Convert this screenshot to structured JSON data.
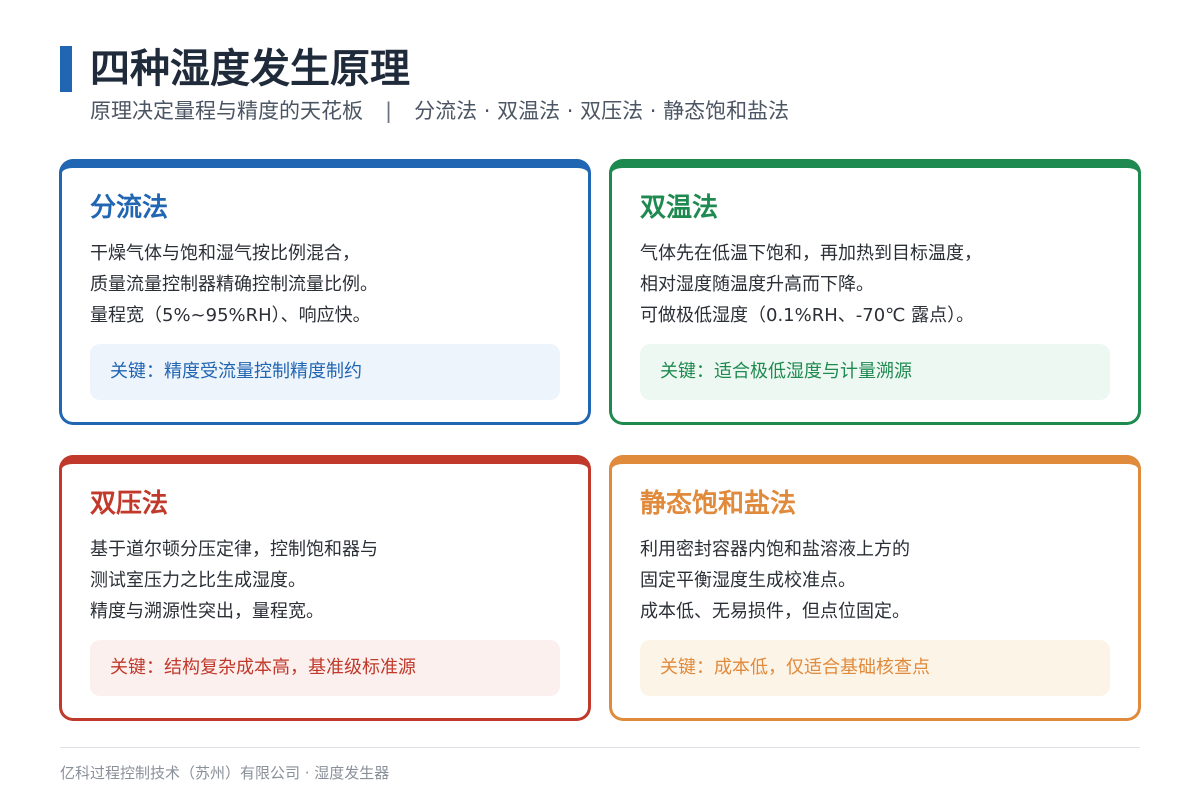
{
  "header": {
    "title": "四种湿度发生原理",
    "subtitle_left": "原理决定量程与精度的天花板",
    "subtitle_sep": "|",
    "subtitle_right": "分流法 · 双温法 · 双压法 · 静态饱和盐法"
  },
  "cards": [
    {
      "title": "分流法",
      "color": "#2166b2",
      "bg": "#eef4fc",
      "lines": [
        "干燥气体与饱和湿气按比例混合，",
        "质量流量控制器精确控制流量比例。",
        "量程宽（5%~95%RH）、响应快。"
      ],
      "key": "关键：精度受流量控制精度制约"
    },
    {
      "title": "双温法",
      "color": "#1e8a50",
      "bg": "#eef8f2",
      "lines": [
        "气体先在低温下饱和，再加热到目标温度，",
        "相对湿度随温度升高而下降。",
        "可做极低湿度（0.1%RH、-70℃ 露点）。"
      ],
      "key": "关键：适合极低湿度与计量溯源"
    },
    {
      "title": "双压法",
      "color": "#c0392b",
      "bg": "#fcf0ef",
      "lines": [
        "基于道尔顿分压定律，控制饱和器与",
        "测试室压力之比生成湿度。",
        "精度与溯源性突出，量程宽。"
      ],
      "key": "关键：结构复杂成本高，基准级标准源"
    },
    {
      "title": "静态饱和盐法",
      "color": "#e08a3c",
      "bg": "#fdf4e8",
      "lines": [
        "利用密封容器内饱和盐溶液上方的",
        "固定平衡湿度生成校准点。",
        "成本低、无易损件，但点位固定。"
      ],
      "key": "关键：成本低，仅适合基础核查点"
    }
  ],
  "footer": {
    "text": "亿科过程控制技术（苏州）有限公司 · 湿度发生器"
  }
}
